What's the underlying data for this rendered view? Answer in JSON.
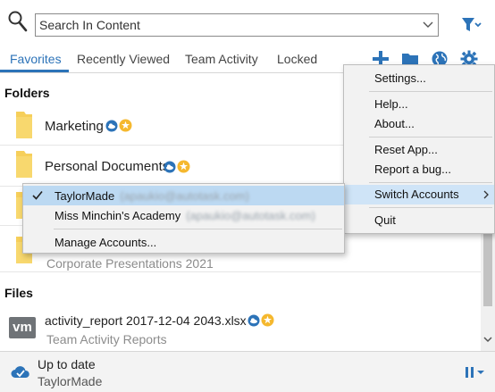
{
  "search": {
    "placeholder": "Search In Content"
  },
  "tabs": [
    {
      "label": "Favorites",
      "active": true
    },
    {
      "label": "Recently Viewed",
      "active": false
    },
    {
      "label": "Team Activity",
      "active": false
    },
    {
      "label": "Locked",
      "active": false
    }
  ],
  "toolbar_icons": [
    "add-icon",
    "folder-icon",
    "globe-icon",
    "gear-icon"
  ],
  "sections": {
    "folders": "Folders",
    "files": "Files"
  },
  "folders": [
    {
      "name": "Marketing",
      "subtitle": ""
    },
    {
      "name": "Personal Documents",
      "subtitle": ""
    },
    {
      "name": "",
      "subtitle": ""
    },
    {
      "name": "",
      "subtitle": "Corporate Presentations 2021"
    }
  ],
  "files": [
    {
      "name": "activity_report 2017-12-04 2043.xlsx",
      "subtitle": "Team Activity Reports",
      "icon": "vm"
    }
  ],
  "menu": {
    "settings": "Settings...",
    "help": "Help...",
    "about": "About...",
    "reset": "Reset App...",
    "report_bug": "Report a bug...",
    "switch_accounts": "Switch Accounts",
    "quit": "Quit"
  },
  "accounts_menu": {
    "items": [
      {
        "name": "TaylorMade",
        "email": "(apaukio@autotask.com)",
        "checked": true
      },
      {
        "name": "Miss Minchin's Academy",
        "email": "(apaukio@autotask.com)",
        "checked": false
      }
    ],
    "manage": "Manage Accounts..."
  },
  "footer": {
    "status": "Up to date",
    "account": "TaylorMade"
  },
  "colors": {
    "accent": "#2c73b8",
    "folder": "#f6cf5a",
    "star": "#f5b82e",
    "highlight": "#cfe4f7"
  }
}
